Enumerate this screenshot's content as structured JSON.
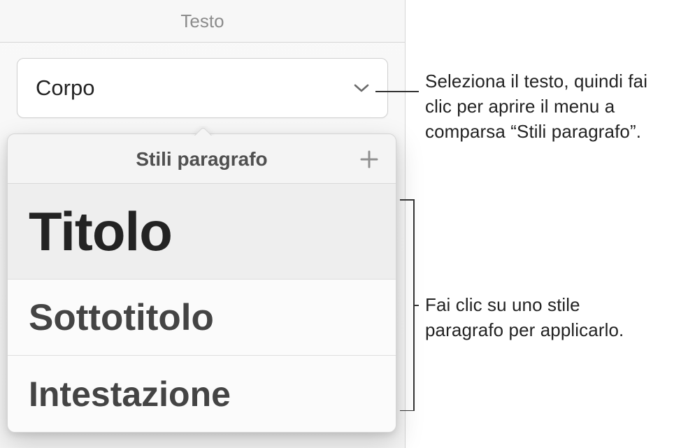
{
  "panel": {
    "header_label": "Testo",
    "current_style": "Corpo"
  },
  "popover": {
    "title": "Stili paragrafo",
    "items": {
      "titolo": "Titolo",
      "sottotitolo": "Sottotitolo",
      "intestazione": "Intestazione"
    }
  },
  "callouts": {
    "select_style": "Seleziona il testo, quindi fai clic per aprire il menu a comparsa “Stili paragrafo”.",
    "click_style": "Fai clic su uno stile paragrafo per applicarlo."
  }
}
